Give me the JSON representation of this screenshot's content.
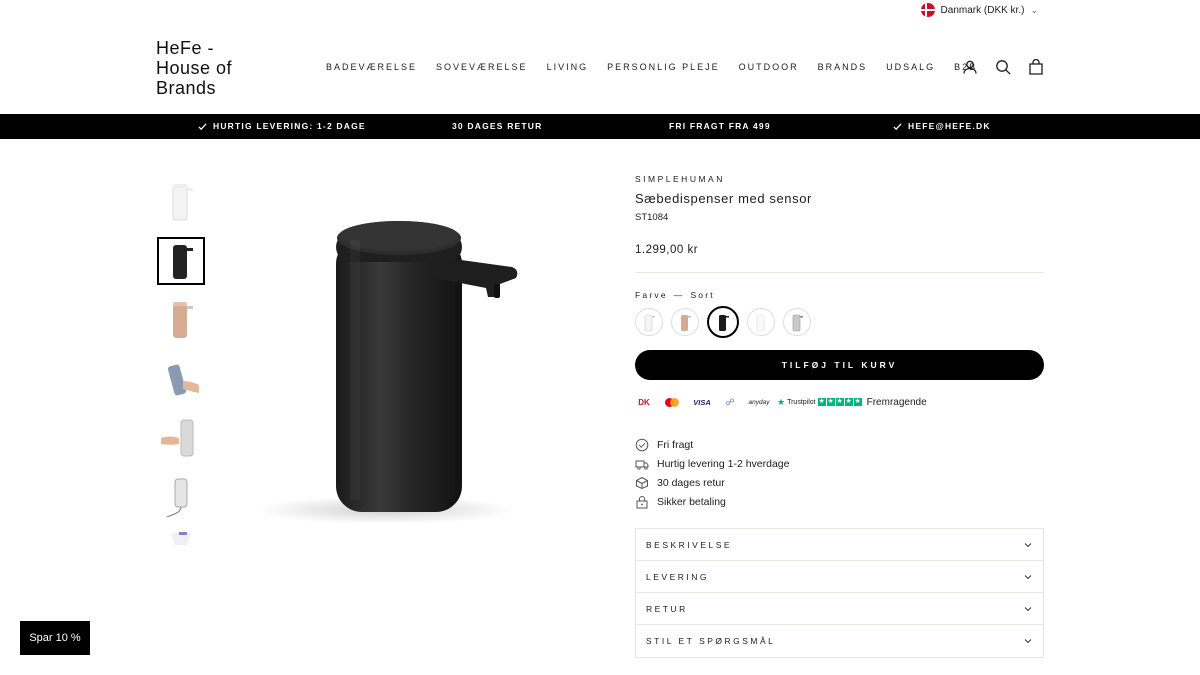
{
  "topbar": {
    "country_label": "Danmark (DKK kr.)"
  },
  "header": {
    "logo": "HeFe - House of Brands",
    "nav": [
      "BADEVÆRELSE",
      "SOVEVÆRELSE",
      "LIVING",
      "PERSONLIG PLEJE",
      "OUTDOOR",
      "BRANDS",
      "UDSALG",
      "B2B"
    ],
    "icons": [
      "account-icon",
      "search-icon",
      "cart-icon"
    ]
  },
  "announcements": [
    "HURTIG LEVERING: 1-2 DAGE",
    "30 DAGES RETUR",
    "FRI FRAGT FRA 499",
    "HEFE@HEFE.DK"
  ],
  "product": {
    "vendor": "SIMPLEHUMAN",
    "title": "Sæbedispenser med sensor",
    "sku": "ST1084",
    "price": "1.299,00 kr",
    "variant_label": "Farve",
    "variant_sep": "—",
    "variant_value": "Sort",
    "swatches": [
      "white",
      "rose-gold",
      "black",
      "white-2",
      "stainless"
    ],
    "selected_swatch": "black",
    "add_to_cart": "TILFØJ TIL KURV",
    "payments": {
      "dankort": "DK",
      "visa": "VISA",
      "anyday": "anyday",
      "trustpilot": "Trustpilot",
      "rating_word": "Fremragende"
    },
    "usps": [
      "Fri fragt",
      "Hurtig levering 1-2 hverdage",
      "30 dages retur",
      "Sikker betaling"
    ],
    "accordion": [
      "BESKRIVELSE",
      "LEVERING",
      "RETUR",
      "STIL ET SPØRGSMÅL"
    ]
  },
  "thumbnails": [
    "white-dispenser",
    "black-dispenser",
    "rose-gold-dispenser",
    "hand-holding-dispenser",
    "hand-under-dispenser",
    "dispenser-charging",
    "dispenser-partial"
  ],
  "save_badge": "Spar 10 %",
  "colors": {
    "accent": "#000000",
    "text": "#1c1d1d",
    "trustpilot": "#00b67a",
    "flag": "#c8102e"
  }
}
